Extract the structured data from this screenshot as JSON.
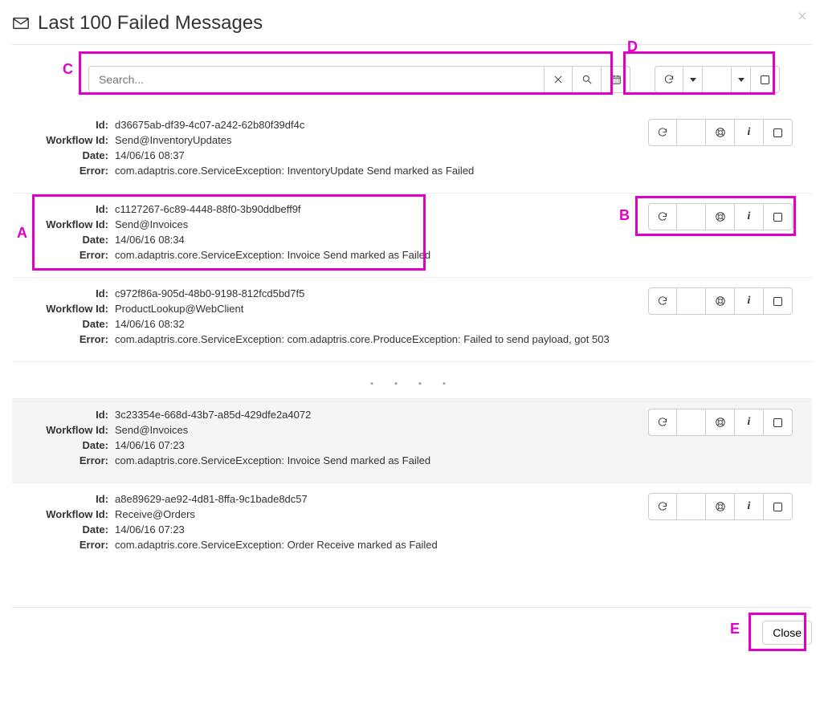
{
  "header": {
    "title": "Last 100 Failed Messages"
  },
  "search": {
    "placeholder": "Search..."
  },
  "annotations": {
    "A": "A",
    "B": "B",
    "C": "C",
    "D": "D",
    "E": "E"
  },
  "labels": {
    "id": "Id:",
    "workflow": "Workflow Id:",
    "date": "Date:",
    "error": "Error:",
    "close": "Close"
  },
  "messages": [
    {
      "id": "d36675ab-df39-4c07-a242-62b80f39df4c",
      "workflow": "Send@InventoryUpdates",
      "date": "14/06/16 08:37",
      "error": "com.adaptris.core.ServiceException: InventoryUpdate Send marked as Failed",
      "highlight": false
    },
    {
      "id": "c1127267-6c89-4448-88f0-3b90ddbeff9f",
      "workflow": "Send@Invoices",
      "date": "14/06/16 08:34",
      "error": "com.adaptris.core.ServiceException: Invoice Send marked as Failed",
      "highlight": false
    },
    {
      "id": "c972f86a-905d-48b0-9198-812fcd5bd7f5",
      "workflow": "ProductLookup@WebClient",
      "date": "14/06/16 08:32",
      "error": "com.adaptris.core.ServiceException: com.adaptris.core.ProduceException: Failed to send payload, got 503",
      "highlight": false
    },
    {
      "id": "3c23354e-668d-43b7-a85d-429dfe2a4072",
      "workflow": "Send@Invoices",
      "date": "14/06/16 07:23",
      "error": "com.adaptris.core.ServiceException: Invoice Send marked as Failed",
      "highlight": true
    },
    {
      "id": "a8e89629-ae92-4d81-8ffa-9c1bade8dc57",
      "workflow": "Receive@Orders",
      "date": "14/06/16 07:23",
      "error": "com.adaptris.core.ServiceException: Order Receive marked as Failed",
      "highlight": false
    }
  ]
}
